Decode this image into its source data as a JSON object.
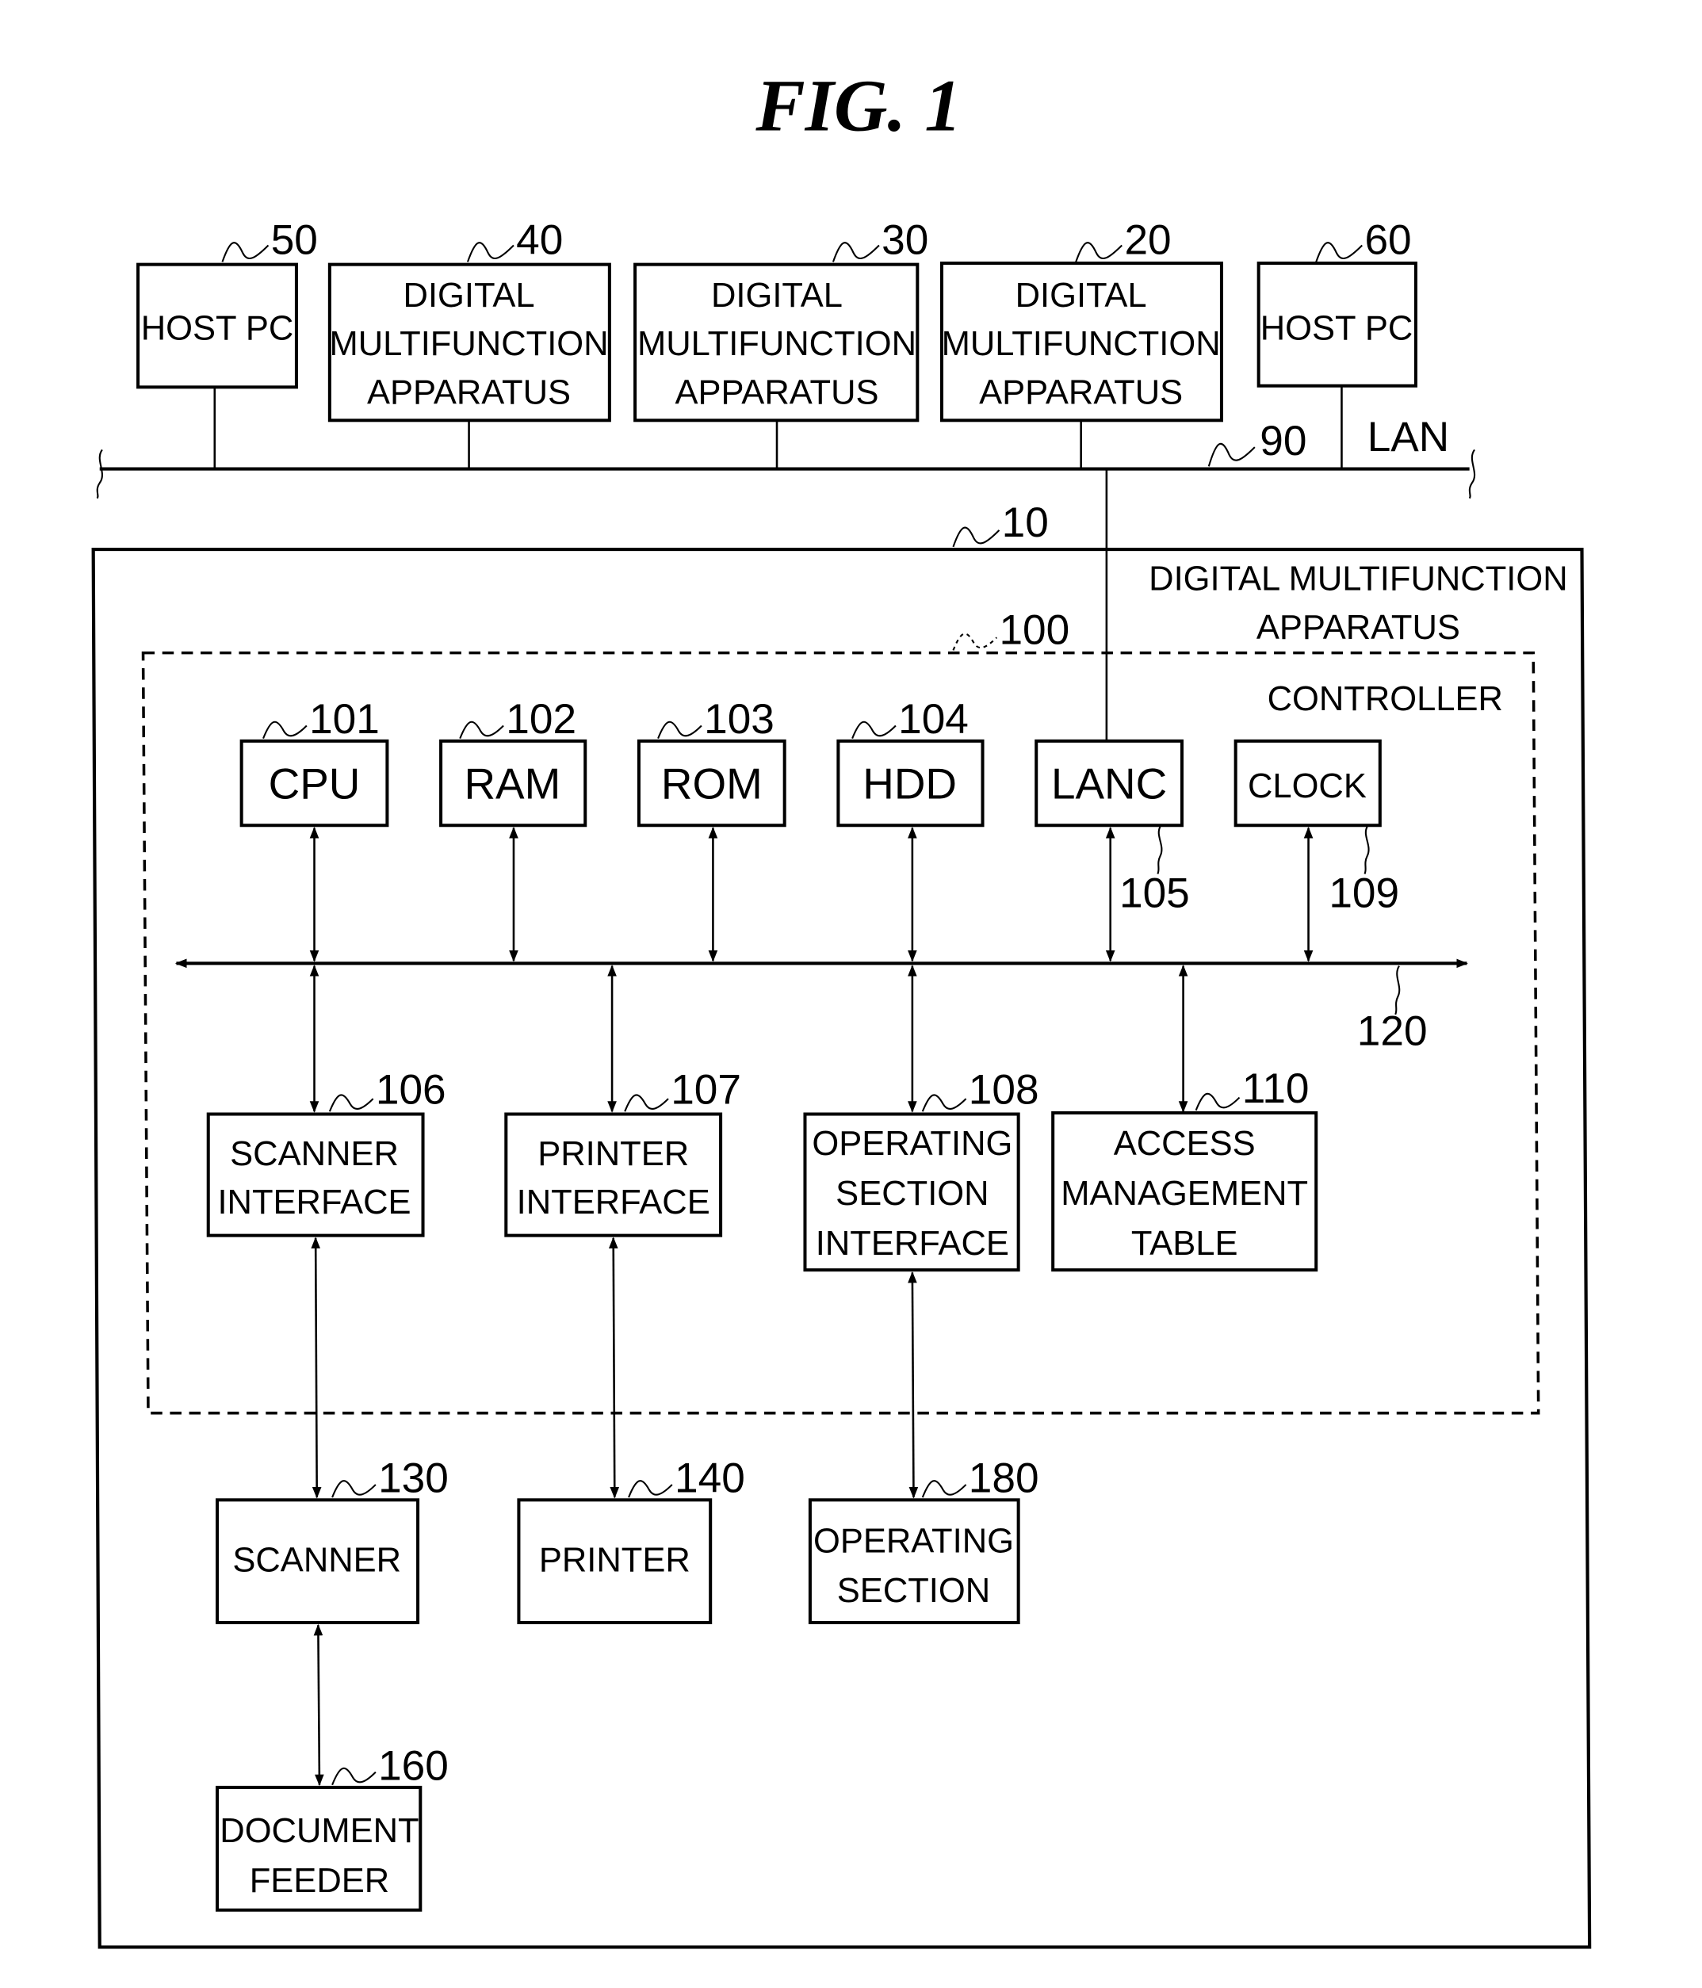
{
  "figure": {
    "title": "FIG. 1"
  },
  "network": {
    "lan_label": "LAN",
    "lan_ref": "90",
    "nodes": [
      {
        "ref": "50",
        "lines": [
          "HOST PC"
        ]
      },
      {
        "ref": "40",
        "lines": [
          "DIGITAL",
          "MULTIFUNCTION",
          "APPARATUS"
        ]
      },
      {
        "ref": "30",
        "lines": [
          "DIGITAL",
          "MULTIFUNCTION",
          "APPARATUS"
        ]
      },
      {
        "ref": "20",
        "lines": [
          "DIGITAL",
          "MULTIFUNCTION",
          "APPARATUS"
        ]
      },
      {
        "ref": "60",
        "lines": [
          "HOST PC"
        ]
      }
    ]
  },
  "apparatus": {
    "ref": "10",
    "label_lines": [
      "DIGITAL MULTIFUNCTION",
      "APPARATUS"
    ]
  },
  "controller": {
    "ref": "100",
    "label": "CONTROLLER",
    "bus_ref": "120",
    "top_units": [
      {
        "ref": "101",
        "label": "CPU"
      },
      {
        "ref": "102",
        "label": "RAM"
      },
      {
        "ref": "103",
        "label": "ROM"
      },
      {
        "ref": "104",
        "label": "HDD"
      },
      {
        "ref": "105",
        "label": "LANC"
      },
      {
        "ref": "109",
        "label": "CLOCK"
      }
    ],
    "interfaces": [
      {
        "ref": "106",
        "lines": [
          "SCANNER",
          "INTERFACE"
        ]
      },
      {
        "ref": "107",
        "lines": [
          "PRINTER",
          "INTERFACE"
        ]
      },
      {
        "ref": "108",
        "lines": [
          "OPERATING",
          "SECTION",
          "INTERFACE"
        ]
      },
      {
        "ref": "110",
        "lines": [
          "ACCESS",
          "MANAGEMENT",
          "TABLE"
        ]
      }
    ]
  },
  "devices": [
    {
      "ref": "130",
      "lines": [
        "SCANNER"
      ]
    },
    {
      "ref": "140",
      "lines": [
        "PRINTER"
      ]
    },
    {
      "ref": "180",
      "lines": [
        "OPERATING",
        "SECTION"
      ]
    },
    {
      "ref": "160",
      "lines": [
        "DOCUMENT",
        "FEEDER"
      ]
    }
  ]
}
